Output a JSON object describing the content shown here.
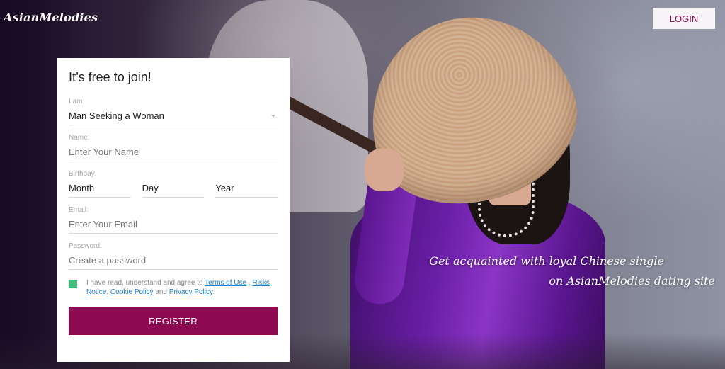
{
  "header": {
    "logo": "AsianMelodies",
    "login_label": "LOGIN"
  },
  "form": {
    "title": "It’s free to join!",
    "iam": {
      "label": "I am:",
      "value": "Man Seeking a Woman"
    },
    "name": {
      "label": "Name:",
      "placeholder": "Enter Your Name"
    },
    "birthday": {
      "label": "Birthday:",
      "month": "Month",
      "day": "Day",
      "year": "Year"
    },
    "email": {
      "label": "Email:",
      "placeholder": "Enter Your Email"
    },
    "password": {
      "label": "Password:",
      "placeholder": "Create a password"
    },
    "consent": {
      "text_before": "I have read, understand and agree to ",
      "terms": "Terms of Use",
      "sep1": " , ",
      "risks": "Risks Notice",
      "sep2": ", ",
      "cookie": "Cookie Policy",
      "sep3": " and ",
      "privacy": "Privacy Policy",
      "end": "."
    },
    "register_label": "REGISTER"
  },
  "tagline": {
    "line1": "Get acquainted with loyal Chinese single",
    "line2": "on AsianMelodies dating site"
  },
  "colors": {
    "brand": "#8d0a52",
    "checkbox": "#3fc07e",
    "link": "#1d7fcc"
  }
}
